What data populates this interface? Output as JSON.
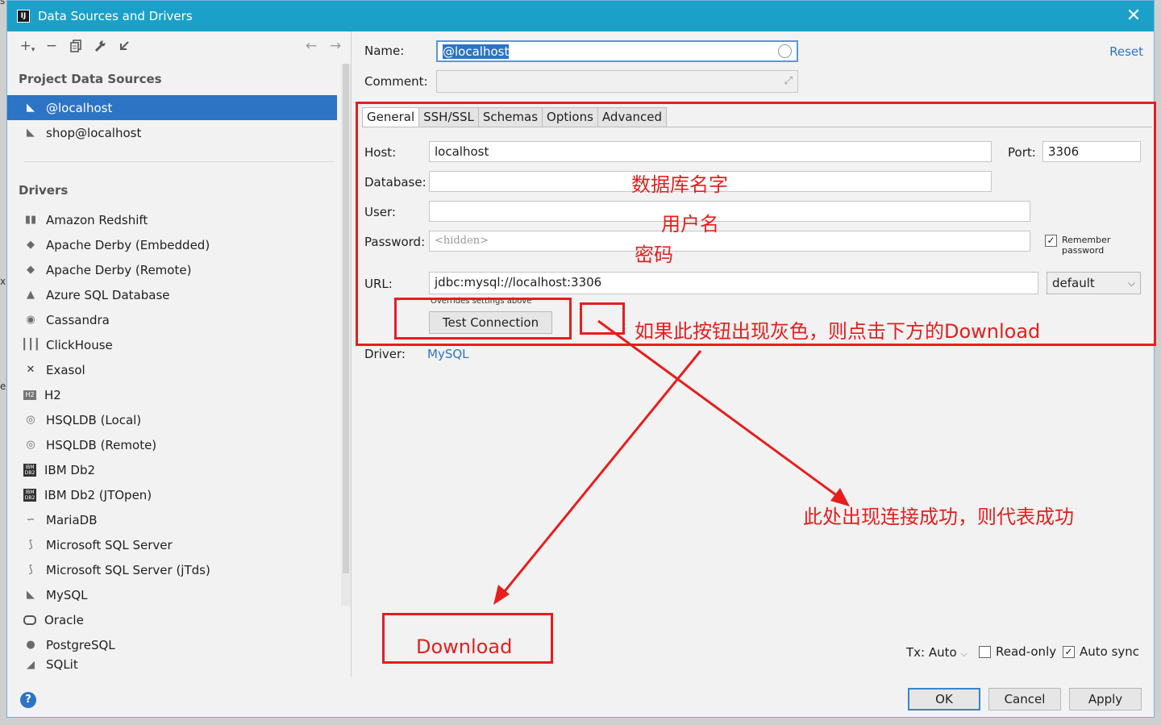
{
  "window": {
    "title": "Data Sources and Drivers",
    "app_icon": "IJ"
  },
  "left": {
    "project_section": "Project Data Sources",
    "data_sources": [
      {
        "label": "@localhost",
        "icon": "mysql-dolphin-icon"
      },
      {
        "label": "shop@localhost",
        "icon": "mysql-dolphin-icon"
      }
    ],
    "drivers_section": "Drivers",
    "drivers": [
      "Amazon Redshift",
      "Apache Derby (Embedded)",
      "Apache Derby (Remote)",
      "Azure SQL Database",
      "Cassandra",
      "ClickHouse",
      "Exasol",
      "H2",
      "HSQLDB (Local)",
      "HSQLDB (Remote)",
      "IBM Db2",
      "IBM Db2 (JTOpen)",
      "MariaDB",
      "Microsoft SQL Server",
      "Microsoft SQL Server (jTds)",
      "MySQL",
      "Oracle",
      "PostgreSQL",
      "SQLit"
    ]
  },
  "form": {
    "name_label": "Name:",
    "name_value": "@localhost",
    "comment_label": "Comment:",
    "comment_value": "",
    "reset_link": "Reset",
    "tabs": [
      "General",
      "SSH/SSL",
      "Schemas",
      "Options",
      "Advanced"
    ],
    "active_tab": "General",
    "host_label": "Host:",
    "host_value": "localhost",
    "port_label": "Port:",
    "port_value": "3306",
    "database_label": "Database:",
    "database_value": "",
    "user_label": "User:",
    "user_value": "",
    "password_label": "Password:",
    "password_placeholder": "<hidden>",
    "remember_password": "Remember password",
    "remember_checked": true,
    "url_label": "URL:",
    "url_value": "jdbc:mysql://localhost:3306",
    "url_mode": "default",
    "overrides_note": "Overrides settings above",
    "test_connection": "Test Connection",
    "driver_label": "Driver:",
    "driver_link": "MySQL"
  },
  "footer": {
    "tx_label": "Tx: Auto",
    "readonly_label": "Read-only",
    "readonly_checked": false,
    "autosync_label": "Auto sync",
    "autosync_checked": true,
    "ok": "OK",
    "cancel": "Cancel",
    "apply": "Apply",
    "help": "?"
  },
  "annotations": {
    "database_hint": "数据库名字",
    "user_hint": "用户名",
    "password_hint": "密码",
    "button_hint": "如果此按钮出现灰色，则点击下方的Download",
    "success_hint": "此处出现连接成功，则代表成功",
    "download": "Download",
    "color": "#e61e1e"
  },
  "edge_fragments": [
    "s",
    "x",
    "es"
  ]
}
